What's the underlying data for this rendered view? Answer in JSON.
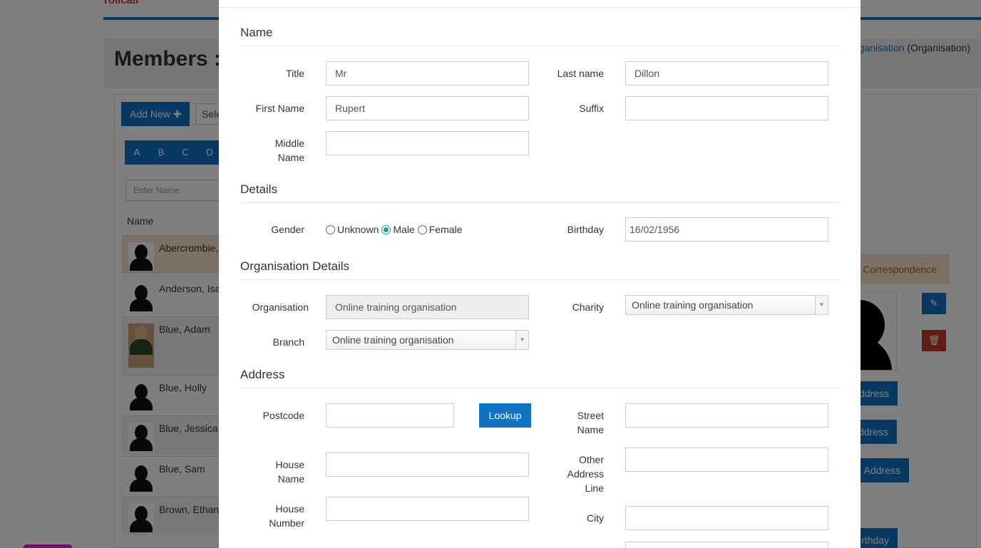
{
  "background": {
    "logo": "rollcall",
    "page_title": "Members :",
    "breadcrumb_prefix": "rganisation",
    "breadcrumb_current": "(Organisation)",
    "add_new_label": "Add New ✚",
    "select_label": "Sele",
    "alphabet": [
      "A",
      "B",
      "C",
      "D"
    ],
    "name_placeholder": "Enter Name",
    "name_column": "Name",
    "members": [
      {
        "name": "Abercrombie,",
        "highlight": true
      },
      {
        "name": "Anderson, Isa"
      },
      {
        "name": "Blue, Adam",
        "photo": true
      },
      {
        "name": "Blue, Holly"
      },
      {
        "name": "Blue, Jessica"
      },
      {
        "name": "Blue, Sam"
      },
      {
        "name": "Brown, Ethan"
      }
    ],
    "correspondence_tab": "Correspondence",
    "side_buttons": [
      "ddress",
      "ddress",
      "Address",
      "rthday"
    ]
  },
  "modal": {
    "sections": {
      "name": "Name",
      "details": "Details",
      "organisation": "Organisation Details",
      "address": "Address"
    },
    "labels": {
      "title": "Title",
      "last_name": "Last name",
      "first_name": "First Name",
      "suffix": "Suffix",
      "middle_name_1": "Middle",
      "middle_name_2": "Name",
      "gender": "Gender",
      "birthday": "Birthday",
      "organisation": "Organisation",
      "charity": "Charity",
      "branch": "Branch",
      "postcode": "Postcode",
      "street_1": "Street",
      "street_2": "Name",
      "house_name_1": "House",
      "house_name_2": "Name",
      "other_1": "Other",
      "other_2": "Address",
      "other_3": "Line",
      "house_number_1": "House",
      "house_number_2": "Number",
      "city": "City"
    },
    "values": {
      "title": "Mr",
      "last_name": "Dillon",
      "first_name": "Rupert",
      "suffix": "",
      "middle_name": "",
      "birthday": "16/02/1956",
      "organisation": "Online training organisation",
      "charity": "Online training organisation",
      "branch": "Online training organisation",
      "postcode": "",
      "street_name": "",
      "house_name": "",
      "other_address_line": "",
      "house_number": "",
      "city": ""
    },
    "gender_options": [
      "Unknown",
      "Male",
      "Female"
    ],
    "gender_selected": "Male",
    "lookup_label": "Lookup"
  },
  "colors": {
    "primary": "#0f73c4",
    "danger": "#c0392b",
    "highlight_row": "#f7e1c8",
    "radio_checked": "#1aa0a8"
  }
}
